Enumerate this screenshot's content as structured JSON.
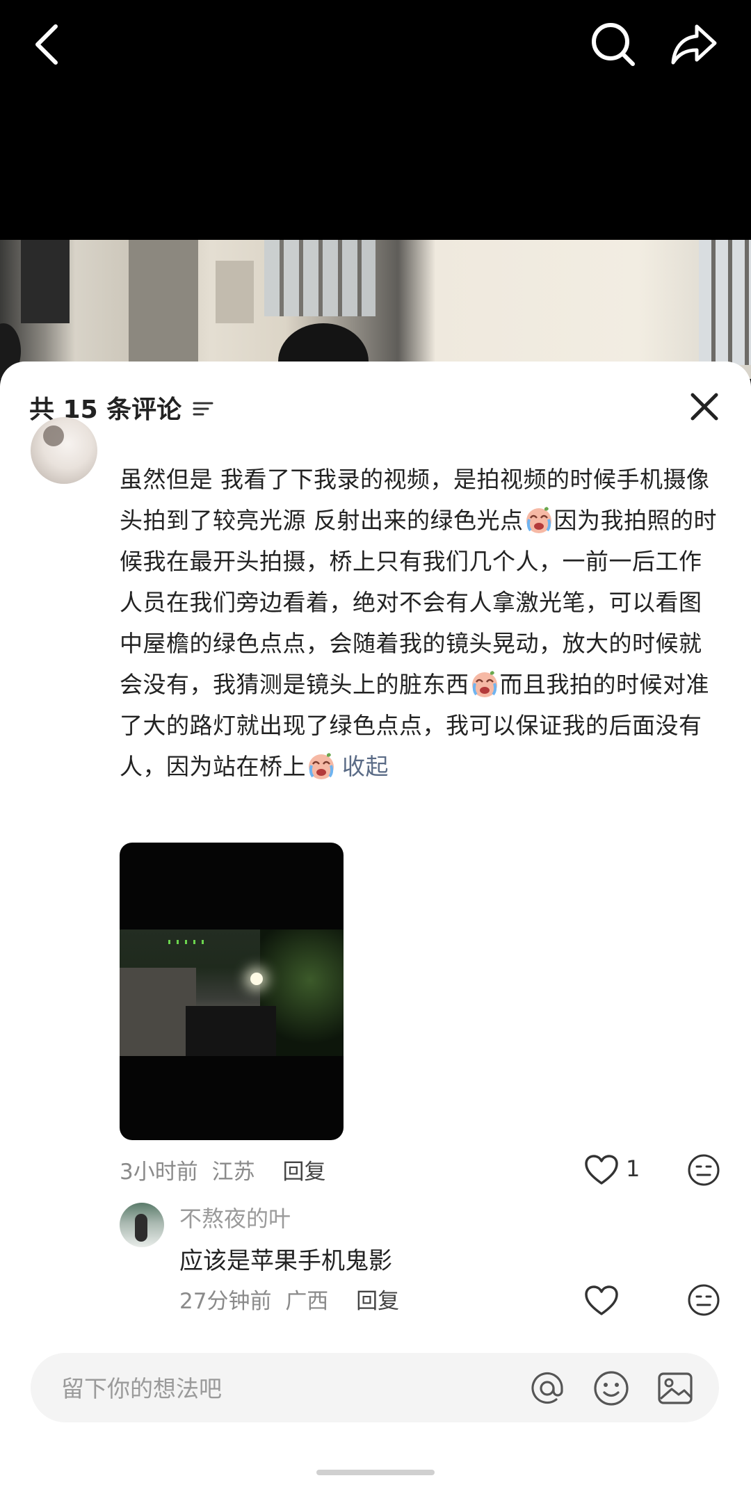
{
  "header": {
    "icons": [
      "back-icon",
      "search-icon",
      "share-icon"
    ]
  },
  "comments_panel": {
    "title": "共 15 条评论",
    "sort_icon": "filter-lines-icon",
    "close_icon": "close-icon"
  },
  "comment": {
    "text_segments": [
      "虽然但是 我看了下我录的视频，是拍视频的时候手机摄像头拍到了较亮光源 反射出来的绿色光点",
      "因为我拍照的时候我在最开头拍摄，桥上只有我们几个人，一前一后工作人员在我们旁边看着，绝对不会有人拿激光笔，可以看图中屋檐的绿色点点，会随着我的镜头晃动，放大的时候就会没有，我猜测是镜头上的脏东西",
      "而且我拍的时候对准了大的路灯就出现了绿色点点，我可以保证我的后面没有人，因为站在桥上",
      ""
    ],
    "emoji": "crying-emoji",
    "collapse_label": "收起",
    "time": "3小时前",
    "location": "江苏",
    "reply_label": "回复",
    "like_count": "1"
  },
  "reply": {
    "username": "不熬夜的叶",
    "text": "应该是苹果手机鬼影",
    "time": "27分钟前",
    "location": "广西",
    "reply_label": "回复"
  },
  "input": {
    "placeholder": "留下你的想法吧",
    "icons": [
      "at-icon",
      "emoji-icon",
      "image-icon"
    ]
  },
  "colors": {
    "accent_link": "#5a6b86",
    "meta_text": "#8a8a8a"
  }
}
